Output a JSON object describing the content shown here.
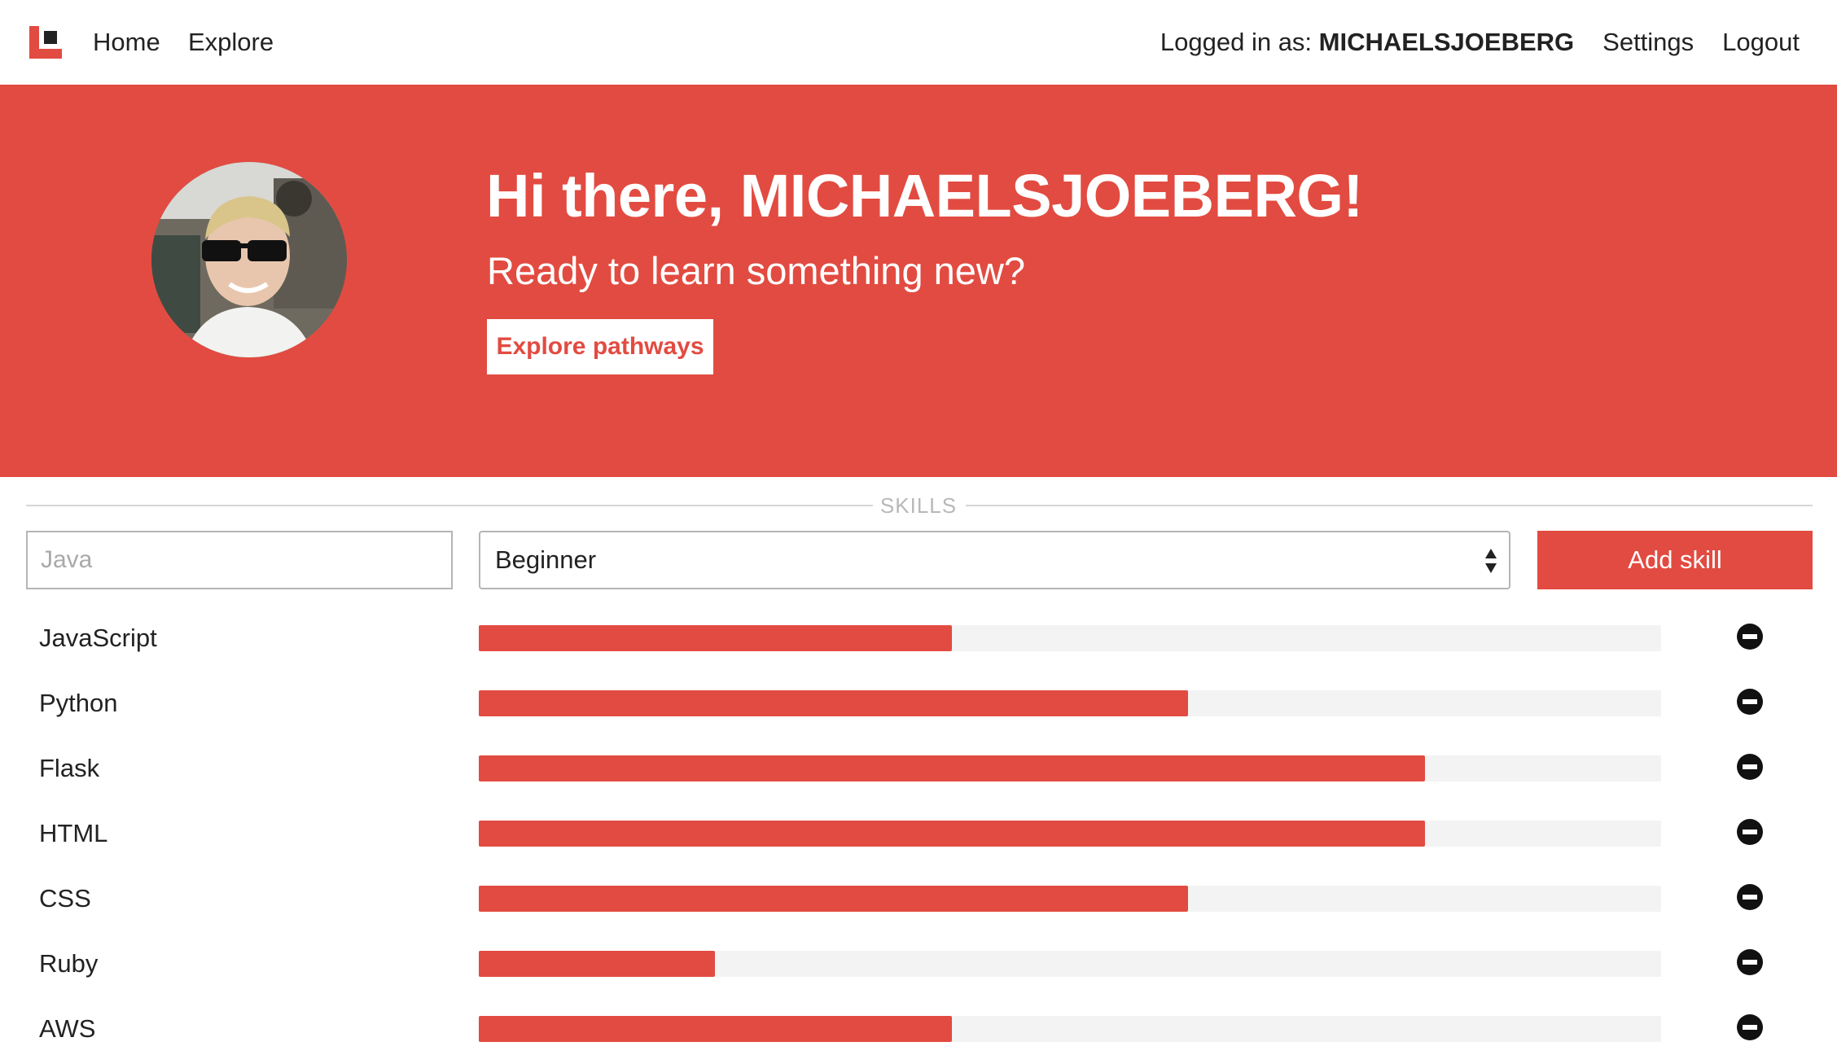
{
  "nav": {
    "home_label": "Home",
    "explore_label": "Explore",
    "logged_in_prefix": "Logged in as:",
    "username": "MICHAELSJOEBERG",
    "settings_label": "Settings",
    "logout_label": "Logout"
  },
  "hero": {
    "title": "Hi there, MICHAELSJOEBERG!",
    "subtitle": "Ready to learn something new?",
    "button_label": "Explore pathways",
    "color": "#e24b41"
  },
  "skills": {
    "section_title": "SKILLS",
    "input_placeholder": "Java",
    "level_selected": "Beginner",
    "add_button_label": "Add skill",
    "items": [
      {
        "name": "JavaScript",
        "level": 0.4
      },
      {
        "name": "Python",
        "level": 0.6
      },
      {
        "name": "Flask",
        "level": 0.8
      },
      {
        "name": "HTML",
        "level": 0.8
      },
      {
        "name": "CSS",
        "level": 0.6
      },
      {
        "name": "Ruby",
        "level": 0.2
      },
      {
        "name": "AWS",
        "level": 0.4
      }
    ]
  }
}
